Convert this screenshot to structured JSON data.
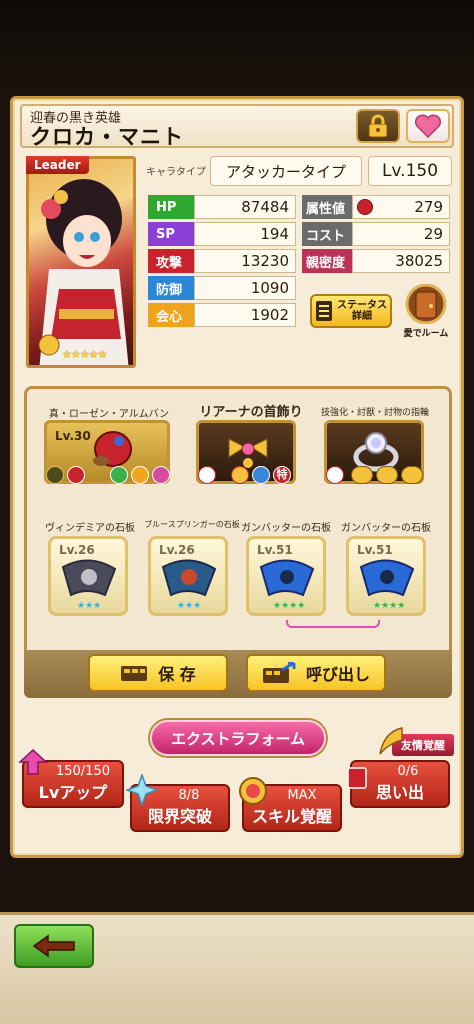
{
  "character": {
    "subtitle": "迎春の黒き英雄",
    "name": "クロカ・マニト",
    "leader_tag": "Leader",
    "stars": "★★★★★",
    "chara_type_label": "キャラタイプ",
    "chara_type": "アタッカータイプ",
    "level": "Lv.150"
  },
  "stats": {
    "hp_label": "HP",
    "hp": "87484",
    "sp_label": "SP",
    "sp": "194",
    "atk_label": "攻撃",
    "atk": "13230",
    "def_label": "防御",
    "def": "1090",
    "crit_label": "会心",
    "crit": "1902",
    "attr_label": "属性値",
    "attr": "279",
    "cost_label": "コスト",
    "cost": "29",
    "affinity_label": "親密度",
    "affinity": "38025"
  },
  "buttons": {
    "status_detail_line1": "ステータス",
    "status_detail_line2": "詳細",
    "room_label": "愛でルーム",
    "save": "保 存",
    "load": "呼び出し",
    "exform": "エクストラフォーム",
    "lv_up": "Lvアップ",
    "lv_up_counter": "150/150",
    "limit_break": "限界突破",
    "limit_break_counter": "8/8",
    "skill_awaken": "スキル覚醒",
    "skill_awaken_counter": "MAX",
    "memory": "思い出",
    "memory_counter": "0/6",
    "friendship_awaken": "友情覚醒"
  },
  "equipment": {
    "weapon": {
      "name": "真・ローゼン・アルムバント",
      "level": "Lv.30"
    },
    "necklace": {
      "name": "リアーナの首飾り"
    },
    "ring": {
      "name": "技強化・討獣・討物の指輪"
    },
    "necklace_badge": "特"
  },
  "tablets": [
    {
      "name": "ヴィンデミアの石板",
      "level": "Lv.26",
      "stars": "★★★"
    },
    {
      "name": "ブルースプリンガーの石板",
      "level": "Lv.26",
      "stars": "★★★"
    },
    {
      "name": "ガンバッターの石板",
      "level": "Lv.51",
      "stars": "★★★★"
    },
    {
      "name": "ガンバッターの石板",
      "level": "Lv.51",
      "stars": "★★★★"
    }
  ],
  "colors": {
    "hp": "#2fa832",
    "sp": "#8c3fd6",
    "atk": "#c8232c",
    "def": "#2a86d6",
    "crit": "#f0a41c",
    "attr": "#6b6b6b",
    "cost": "#6b6b6b",
    "affinity": "#b8325a"
  }
}
